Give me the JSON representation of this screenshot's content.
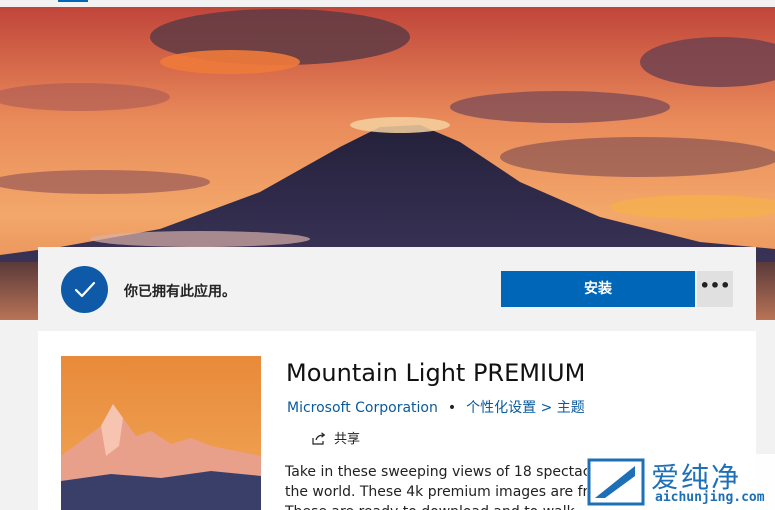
{
  "owned_bar": {
    "message": "你已拥有此应用。",
    "install_label": "安装",
    "more_label": "•••"
  },
  "app": {
    "title": "Mountain Light PREMIUM",
    "publisher": "Microsoft Corporation",
    "separator": "•",
    "category": "个性化设置 > 主题",
    "share_label": "共享",
    "description_lines": [
      "Take in these sweeping views of 18 spectacular",
      "the world. These 4k premium images are free",
      "These are ready to download and to walk..."
    ]
  },
  "watermark": {
    "name": "爱纯净",
    "url": "aichunjing.com"
  },
  "colors": {
    "accent": "#0067b8",
    "check_circle": "#0f5aa8",
    "link": "#0a5a9c"
  },
  "icons": {
    "owned": "checkmark-icon",
    "share": "share-icon",
    "more": "more-icon"
  }
}
